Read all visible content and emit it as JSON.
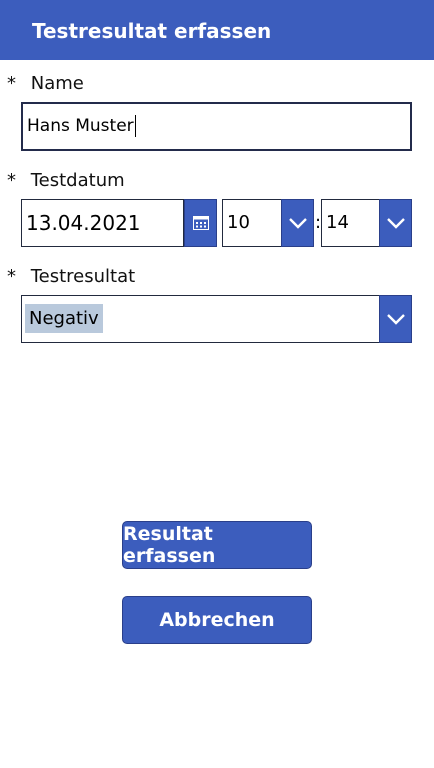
{
  "header": {
    "title": "Testresultat erfassen"
  },
  "form": {
    "required_marker": "*",
    "name": {
      "label": "Name",
      "value": "Hans Muster"
    },
    "date": {
      "label": "Testdatum",
      "value": "13.04.2021",
      "hour": "10",
      "minute": "14",
      "separator": ":"
    },
    "result": {
      "label": "Testresultat",
      "value": "Negativ"
    }
  },
  "actions": {
    "submit_label": "Resultat erfassen",
    "cancel_label": "Abbrechen"
  },
  "colors": {
    "accent": "#3c5dbd",
    "highlight": "#b9c9dc"
  }
}
